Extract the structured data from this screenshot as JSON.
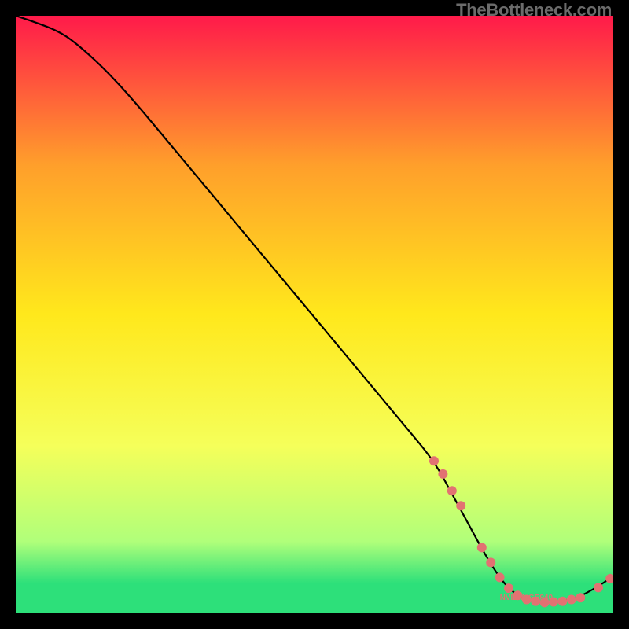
{
  "watermark": "TheBottleneck.com",
  "chart_data": {
    "type": "line",
    "title": "",
    "xlabel": "",
    "ylabel": "",
    "xlim": [
      0,
      100
    ],
    "ylim": [
      0,
      100
    ],
    "background_gradient": {
      "top": "#ff1a4a",
      "upper_mid": "#ff9f2b",
      "mid": "#ffe81c",
      "lower_mid": "#f5ff5a",
      "low": "#b0ff7a",
      "bottom": "#2de07a"
    },
    "curve": {
      "description": "Bottleneck curve; high at left, descends to a minimum around x≈82-88 then rises slightly",
      "x": [
        0,
        3,
        7,
        10,
        15,
        20,
        25,
        30,
        35,
        40,
        45,
        50,
        55,
        60,
        65,
        70,
        73,
        76,
        79,
        82,
        85,
        88,
        91,
        94,
        97,
        100
      ],
      "y": [
        100,
        99,
        97.5,
        95.5,
        91,
        85.5,
        79.5,
        73.5,
        67.5,
        61.5,
        55.5,
        49.5,
        43.5,
        37.5,
        31.5,
        25.5,
        20,
        14.5,
        9,
        4.5,
        2.3,
        1.8,
        2.0,
        2.6,
        4.2,
        6.2
      ]
    },
    "markers": {
      "color": "#e27272",
      "radius": 6,
      "points_x": [
        70,
        71.5,
        73,
        74.5,
        78,
        79.5,
        81,
        82.5,
        84,
        85.5,
        87,
        88.5,
        90,
        91.5,
        93,
        94.5,
        97.5,
        99.5
      ],
      "points_y": [
        25.5,
        23.3,
        20.5,
        18,
        11,
        8.5,
        6,
        4.2,
        3.0,
        2.3,
        2.0,
        1.8,
        1.9,
        2.0,
        2.3,
        2.6,
        4.3,
        5.8
      ],
      "cluster_label": "NVIDIA GE940"
    }
  }
}
